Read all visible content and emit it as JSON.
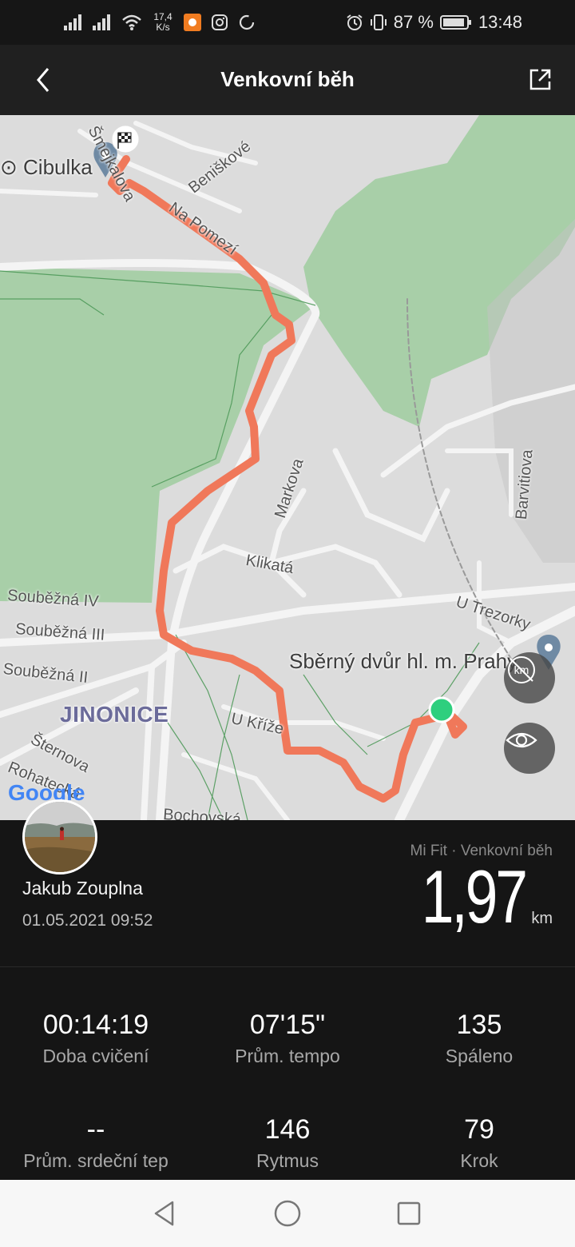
{
  "status_bar": {
    "net_speed_value": "17,4",
    "net_speed_unit": "K/s",
    "battery": "87 %",
    "time": "13:48",
    "icons": [
      "signal-icon",
      "signal-icon",
      "wifi-icon",
      "app-notification-icon",
      "instagram-icon",
      "circle-icon",
      "alarm-icon",
      "vibrate-icon",
      "battery-icon"
    ]
  },
  "app_bar": {
    "title": "Venkovní běh",
    "back_icon": "chevron-left-icon",
    "share_icon": "share-icon"
  },
  "map": {
    "labels": {
      "cibulka": "Cibulka",
      "street_top": "Šmejkalova",
      "beniskove": "Beniškové",
      "na_pomezi": "Na Pomezí",
      "markova": "Markova",
      "klikata": "Klikatá",
      "barvitiova": "Barvitiova",
      "u_trezorky": "U Trezorky",
      "sberny_dvur": "Sběrný dvůr hl. m. Prahy",
      "soubezna_iv": "Souběžná IV",
      "soubezna_iii": "Souběžná III",
      "soubezna_ii": "Souběžná II",
      "jinonice": "JINONICE",
      "u_krize": "U Kříže",
      "sternova": "Šternova",
      "rohatecka": "Rohatecká",
      "bochovska": "Bochovská",
      "google": "Google"
    },
    "route_color": "#F0785A",
    "park_color": "#a8cfa8",
    "start_color": "#2ecf7e",
    "finish_icon": "checkered-flag-icon",
    "km_toggle_icon": "km-off-icon",
    "eye_icon": "eye-icon"
  },
  "summary": {
    "user_name": "Jakub Zouplna",
    "date_time": "01.05.2021 09:52",
    "source": "Mi Fit · Venkovní běh",
    "distance": "1,97",
    "distance_unit": "km"
  },
  "stats": [
    {
      "value": "00:14:19",
      "label": "Doba cvičení"
    },
    {
      "value": "07'15\"",
      "label": "Prům. tempo"
    },
    {
      "value": "135",
      "label": "Spáleno"
    },
    {
      "value": "--",
      "label": "Prům. srdeční tep"
    },
    {
      "value": "146",
      "label": "Rytmus"
    },
    {
      "value": "79",
      "label": "Krok"
    }
  ],
  "nav_bar": {
    "icons": [
      "back-triangle-icon",
      "home-circle-icon",
      "recents-square-icon"
    ]
  }
}
